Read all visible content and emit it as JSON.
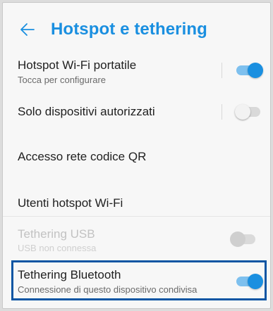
{
  "header": {
    "title": "Hotspot e tethering",
    "back_icon": "back-arrow-icon",
    "accent_color": "#1a8fe0"
  },
  "settings": [
    {
      "label": "Hotspot Wi-Fi portatile",
      "sub": "Tocca per configurare",
      "toggle": "on",
      "enabled": true
    },
    {
      "label": "Solo dispositivi autorizzati",
      "toggle": "off",
      "enabled": true
    },
    {
      "label": "Accesso rete codice QR",
      "enabled": true
    },
    {
      "label": "Utenti hotspot Wi-Fi",
      "enabled": true
    },
    {
      "label": "Tethering USB",
      "sub": "USB non connessa",
      "toggle": "off",
      "enabled": false
    },
    {
      "label": "Tethering Bluetooth",
      "sub": "Connessione di questo dispositivo condivisa",
      "toggle": "on",
      "enabled": true,
      "highlighted": true
    }
  ],
  "highlight_color": "#0b55a3"
}
